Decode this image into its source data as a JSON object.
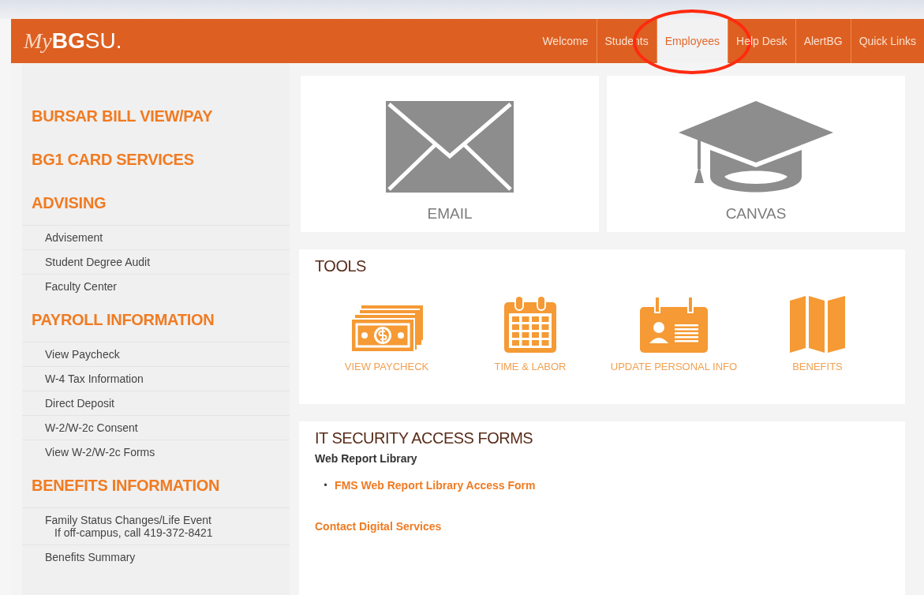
{
  "header": {
    "logo_script": "My",
    "logo_bold": "BG",
    "logo_rest": "SU.",
    "nav": [
      {
        "label": "Welcome",
        "selected": false
      },
      {
        "label": "Students",
        "selected": false
      },
      {
        "label": "Employees",
        "selected": true
      },
      {
        "label": "Help Desk",
        "selected": false
      },
      {
        "label": "AlertBG",
        "selected": false
      },
      {
        "label": "Quick Links",
        "selected": false
      }
    ],
    "annotation": {
      "kind": "ellipse",
      "color": "#ff2a10"
    }
  },
  "sidebar": {
    "sections": [
      {
        "title": "BURSAR BILL VIEW/PAY"
      },
      {
        "title": "BG1 CARD SERVICES"
      },
      {
        "title": "ADVISING",
        "items": [
          {
            "label": "Advisement"
          },
          {
            "label": "Student Degree Audit"
          },
          {
            "label": "Faculty Center"
          }
        ]
      },
      {
        "title": "PAYROLL INFORMATION",
        "items": [
          {
            "label": "View Paycheck"
          },
          {
            "label": "W-4 Tax Information"
          },
          {
            "label": "Direct Deposit"
          },
          {
            "label": "W-2/W-2c Consent"
          },
          {
            "label": "View W-2/W-2c Forms"
          }
        ]
      },
      {
        "title": "BENEFITS INFORMATION",
        "items": [
          {
            "label": "Family Status Changes/Life Event",
            "note": "If off-campus, call 419-372-8421"
          },
          {
            "label": "Benefits Summary"
          }
        ]
      }
    ]
  },
  "tiles": [
    {
      "label": "EMAIL",
      "kind": "envelope"
    },
    {
      "label": "CANVAS",
      "kind": "cap"
    }
  ],
  "tools": {
    "title": "TOOLS",
    "items": [
      {
        "label": "VIEW PAYCHECK",
        "kind": "money"
      },
      {
        "label": "TIME & LABOR",
        "kind": "calendar"
      },
      {
        "label": "UPDATE PERSONAL INFO",
        "kind": "badge"
      },
      {
        "label": "BENEFITS",
        "kind": "map"
      }
    ]
  },
  "forms": {
    "title": "IT SECURITY ACCESS FORMS",
    "subtitle": "Web Report Library",
    "links": [
      {
        "bullet": "•",
        "label": "FMS Web Report Library Access Form"
      }
    ],
    "contact": "Contact Digital Services"
  }
}
